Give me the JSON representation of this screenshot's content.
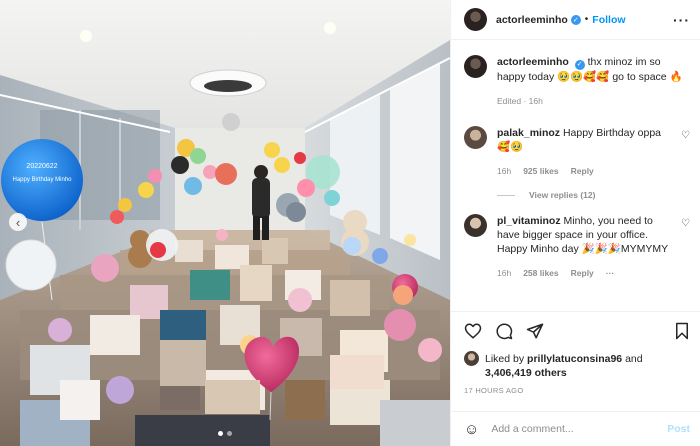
{
  "post": {
    "owner": "actorleeminho",
    "follow_label": "Follow",
    "separator": "•",
    "more_glyph": "···"
  },
  "photo": {
    "description": "Office room filled with birthday balloons and gifts",
    "balloon_text_1": "20220622",
    "balloon_text_2": "Happy Birthday Minho",
    "carousel_dots": 2,
    "active_dot": 1,
    "prev_glyph": "‹"
  },
  "caption": {
    "username": "actorleeminho",
    "text": "thx minoz im so happy today 🥹🥹🥰🥰 go to space 🔥",
    "meta": "Edited · 16h"
  },
  "comments": [
    {
      "username": "palak_minoz",
      "text": "Happy Birthday oppa 🥰🥹",
      "time": "16h",
      "likes": "925 likes",
      "reply": "Reply",
      "replies_label": "View replies (12)"
    },
    {
      "username": "pl_vitaminoz",
      "text": "Minho, you need to have bigger space in your office. Happy Minho day 🎉🎉🎉MYMYMY",
      "time": "16h",
      "likes": "258 likes",
      "reply": "Reply",
      "more": "···"
    }
  ],
  "likes": {
    "prefix": "Liked by",
    "liker": "prillylatuconsina96",
    "and": "and",
    "others": "3,406,419 others"
  },
  "time_ago": "17 HOURS AGO",
  "add_comment": {
    "placeholder": "Add a comment...",
    "post_label": "Post",
    "emoji_glyph": "☺"
  },
  "icons": {
    "heart": "heart-icon",
    "comment": "comment-icon",
    "share": "share-icon",
    "save": "bookmark-icon",
    "verified": "verified-badge-icon"
  },
  "colors": {
    "link_blue": "#0095f6",
    "verified_blue": "#3897f0",
    "muted": "#8e8e8e",
    "text": "#262626"
  }
}
